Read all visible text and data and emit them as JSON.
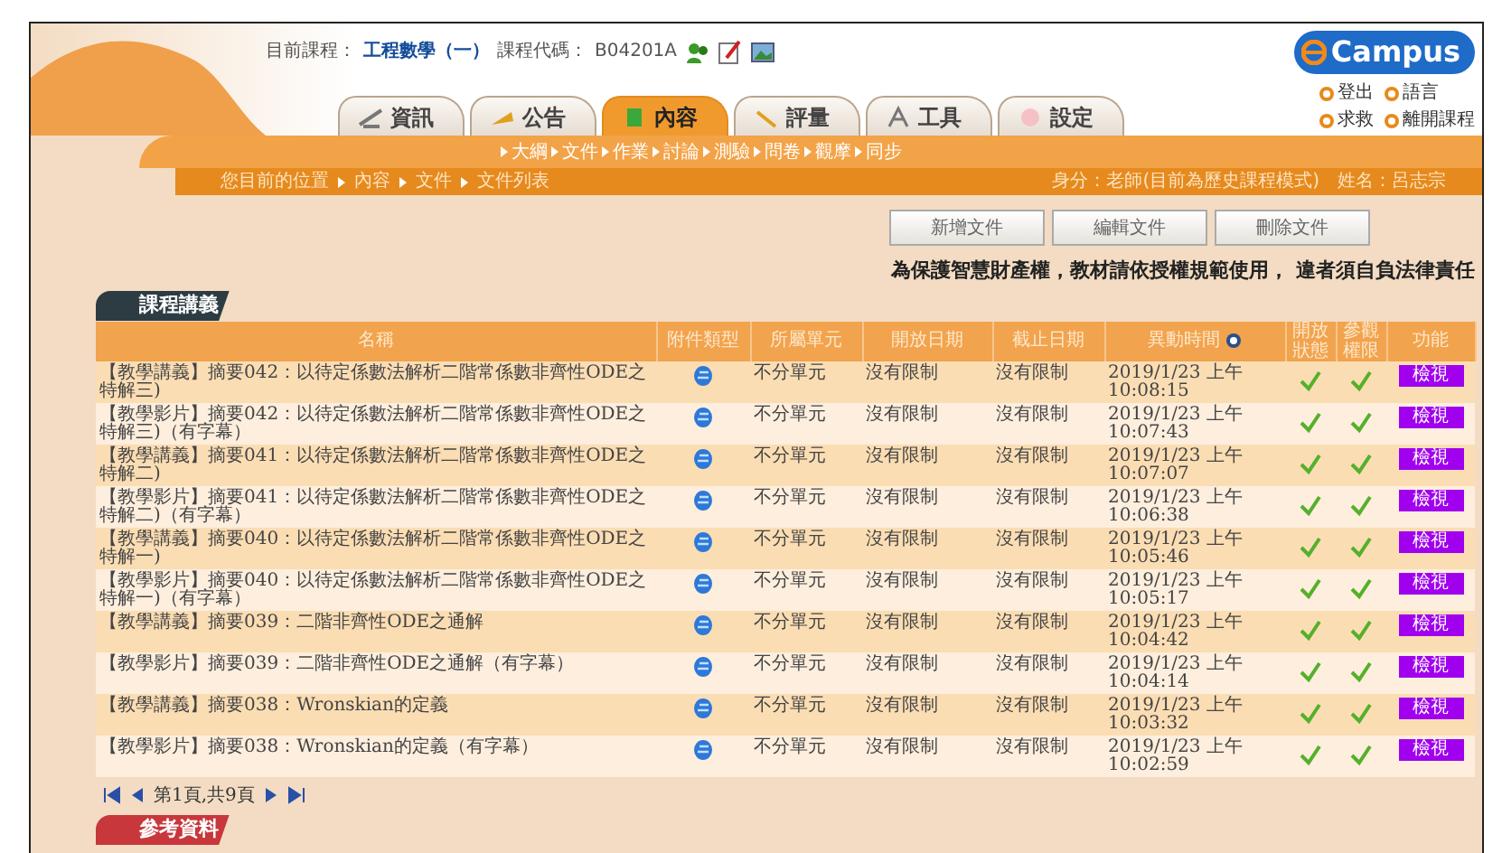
{
  "course_bar": {
    "course_label": "目前課程：",
    "course_name": "工程數學（一）",
    "code_label": "課程代碼：",
    "code": "B04201A"
  },
  "logo": {
    "text": "Campus"
  },
  "user_links": [
    "登出",
    "語言",
    "求救",
    "離開課程"
  ],
  "tabs": [
    {
      "label": "資訊",
      "selected": false
    },
    {
      "label": "公告",
      "selected": false
    },
    {
      "label": "內容",
      "selected": true
    },
    {
      "label": "評量",
      "selected": false
    },
    {
      "label": "工具",
      "selected": false
    },
    {
      "label": "設定",
      "selected": false
    }
  ],
  "subnav": [
    "大綱",
    "文件",
    "作業",
    "討論",
    "測驗",
    "問卷",
    "觀摩",
    "同步"
  ],
  "breadcrumb": [
    "您目前的位置",
    "內容",
    "文件",
    "文件列表"
  ],
  "user_info": "身分：老師(目前為歷史課程模式)　姓名：呂志宗",
  "buttons": [
    "新增文件",
    "編輯文件",
    "刪除文件"
  ],
  "notice": "為保護智慧財產權，教材請依授權規範使用， 違者須自負法律責任",
  "section": {
    "title": "課程講義"
  },
  "table": {
    "columns": [
      "名稱",
      "附件類型",
      "所屬單元",
      "開放日期",
      "截止日期",
      "異動時間",
      "開放狀態",
      "參觀權限",
      "功能"
    ],
    "rows": [
      {
        "name": "【教學講義】摘要042：以待定係數法解析二階常係數非齊性ODE之特解三)",
        "unit": "不分單元",
        "open_date": "沒有限制",
        "close_date": "沒有限制",
        "modified": "2019/1/23 上午 10:08:15",
        "open_status": true,
        "view_permission": true,
        "action": "檢視"
      },
      {
        "name": "【教學影片】摘要042：以待定係數法解析二階常係數非齊性ODE之特解三)（有字幕）",
        "unit": "不分單元",
        "open_date": "沒有限制",
        "close_date": "沒有限制",
        "modified": "2019/1/23 上午 10:07:43",
        "open_status": true,
        "view_permission": true,
        "action": "檢視"
      },
      {
        "name": "【教學講義】摘要041：以待定係數法解析二階常係數非齊性ODE之特解二)",
        "unit": "不分單元",
        "open_date": "沒有限制",
        "close_date": "沒有限制",
        "modified": "2019/1/23 上午 10:07:07",
        "open_status": true,
        "view_permission": true,
        "action": "檢視"
      },
      {
        "name": "【教學影片】摘要041：以待定係數法解析二階常係數非齊性ODE之特解二)（有字幕）",
        "unit": "不分單元",
        "open_date": "沒有限制",
        "close_date": "沒有限制",
        "modified": "2019/1/23 上午 10:06:38",
        "open_status": true,
        "view_permission": true,
        "action": "檢視"
      },
      {
        "name": "【教學講義】摘要040：以待定係數法解析二階常係數非齊性ODE之特解一)",
        "unit": "不分單元",
        "open_date": "沒有限制",
        "close_date": "沒有限制",
        "modified": "2019/1/23 上午 10:05:46",
        "open_status": true,
        "view_permission": true,
        "action": "檢視"
      },
      {
        "name": "【教學影片】摘要040：以待定係數法解析二階常係數非齊性ODE之特解一)（有字幕）",
        "unit": "不分單元",
        "open_date": "沒有限制",
        "close_date": "沒有限制",
        "modified": "2019/1/23 上午 10:05:17",
        "open_status": true,
        "view_permission": true,
        "action": "檢視"
      },
      {
        "name": "【教學講義】摘要039：二階非齊性ODE之通解",
        "unit": "不分單元",
        "open_date": "沒有限制",
        "close_date": "沒有限制",
        "modified": "2019/1/23 上午 10:04:42",
        "open_status": true,
        "view_permission": true,
        "action": "檢視"
      },
      {
        "name": "【教學影片】摘要039：二階非齊性ODE之通解（有字幕）",
        "unit": "不分單元",
        "open_date": "沒有限制",
        "close_date": "沒有限制",
        "modified": "2019/1/23 上午 10:04:14",
        "open_status": true,
        "view_permission": true,
        "action": "檢視"
      },
      {
        "name": "【教學講義】摘要038：Wronskian的定義",
        "unit": "不分單元",
        "open_date": "沒有限制",
        "close_date": "沒有限制",
        "modified": "2019/1/23 上午 10:03:32",
        "open_status": true,
        "view_permission": true,
        "action": "檢視"
      },
      {
        "name": "【教學影片】摘要038：Wronskian的定義（有字幕）",
        "unit": "不分單元",
        "open_date": "沒有限制",
        "close_date": "沒有限制",
        "modified": "2019/1/23 上午 10:02:59",
        "open_status": true,
        "view_permission": true,
        "action": "檢視"
      }
    ]
  },
  "pagination": {
    "text": "第1頁,共9頁"
  },
  "next_section": {
    "title": "參考資料"
  }
}
